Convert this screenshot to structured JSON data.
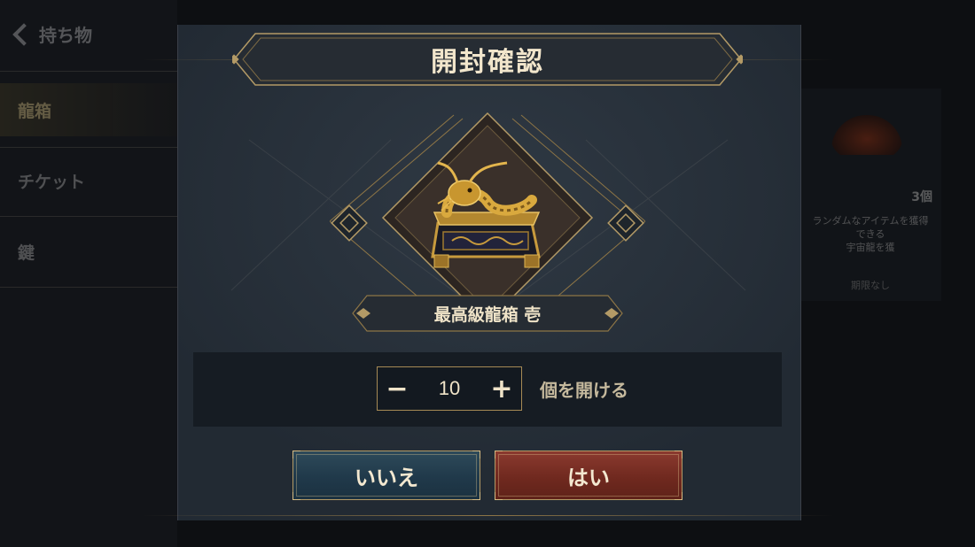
{
  "background": {
    "back_label": "持ち物",
    "categories": [
      {
        "label": "龍箱",
        "active": true
      },
      {
        "label": "チケット",
        "active": false
      },
      {
        "label": "鍵",
        "active": false
      }
    ],
    "card": {
      "count": "3個",
      "description_line1": "ランダムなアイテムを獲得",
      "description_line2": "できる",
      "description_line3": "宇宙龍を獲",
      "state": "期限なし"
    }
  },
  "dialog": {
    "title": "開封確認",
    "item_name": "最高級龍箱 壱",
    "item_icon": "dragon-chest-icon",
    "quantity": {
      "value": "10",
      "decrement_symbol": "−",
      "increment_symbol": "+",
      "suffix": "個を開ける"
    },
    "buttons": {
      "cancel_label": "いいえ",
      "confirm_label": "はい"
    }
  },
  "colors": {
    "dialog_bg": "#222a33",
    "gold_accent": "#b39a66",
    "cancel_button": "#20394a",
    "confirm_button": "#70291f"
  }
}
